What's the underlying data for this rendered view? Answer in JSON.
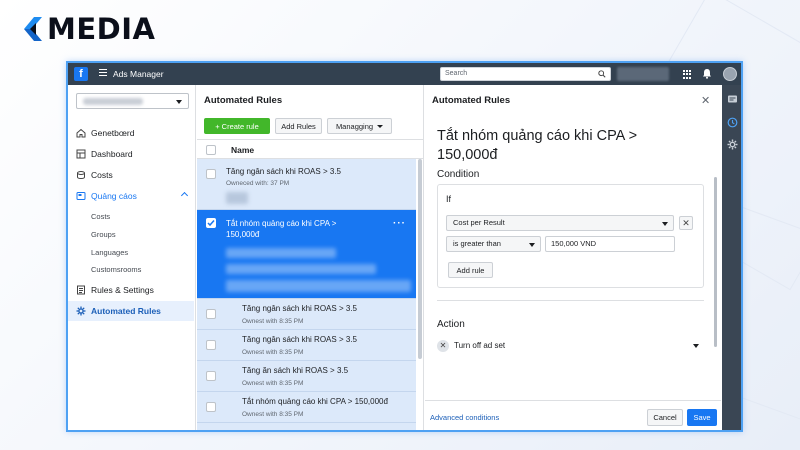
{
  "brand": {
    "logo_text": "MEDIA"
  },
  "topbar": {
    "app_title": "Ads Manager",
    "search_placeholder": "Search"
  },
  "sidebar": {
    "items": [
      {
        "label": "Genetbœrd",
        "icon": "home-icon"
      },
      {
        "label": "Dashboard",
        "icon": "dashboard-icon"
      },
      {
        "label": "Costs",
        "icon": "coins-icon"
      },
      {
        "label": "Quảng cáos",
        "icon": "ads-icon",
        "expanded": true
      },
      {
        "label": "Costs",
        "sub": true
      },
      {
        "label": "Groups",
        "sub": true
      },
      {
        "label": "Languages",
        "sub": true
      },
      {
        "label": "Customsrooms",
        "sub": true
      },
      {
        "label": "Rules & Settings",
        "icon": "rules-icon"
      },
      {
        "label": "Automated Rules",
        "icon": "gear-icon",
        "active": true
      }
    ]
  },
  "list": {
    "title": "Automated Rules",
    "create_label": "+ Create rule",
    "add_label": "Add Rules",
    "manage_label": "Managging",
    "column_name": "Name",
    "rows": [
      {
        "name": "Tăng ngân sách khi ROAS > 3.5",
        "meta": "Owneced with: 37 PM"
      },
      {
        "name": "Tắt nhóm quảng cáo khi CPA >\n150,000đ",
        "meta": "",
        "selected": true
      },
      {
        "name": "Tăng ngân sách khi ROAS > 3.5",
        "meta": "Ownest with 8:35 PM"
      },
      {
        "name": "Tăng ngân sách khi ROAS > 3.5",
        "meta": "Ownest with 8:35 PM"
      },
      {
        "name": "Tăng ăn sách khi ROAS > 3.5",
        "meta": "Ownest with 8:35 PM"
      },
      {
        "name": "Tắt nhóm quảng cáo khi CPA > 150,000đ",
        "meta": "Ownest with 8:35 PM"
      }
    ]
  },
  "detail": {
    "panel_title": "Automated Rules",
    "heading": "Tắt nhóm quảng cáo khi CPA > 150,000đ",
    "condition_label": "Condition",
    "if_label": "If",
    "metric": "Cost per Result",
    "operator": "is greater than",
    "value": "150,000 VND",
    "add_rule_label": "Add rule",
    "action_label": "Action",
    "action_value": "Turn off ad set",
    "advanced_link": "Advanced conditions",
    "cancel_label": "Cancel",
    "save_label": "Save"
  },
  "colors": {
    "primary": "#1877f2",
    "green": "#42b72a",
    "topbar": "#334150",
    "selected_row": "#1877f2",
    "row_bg": "#dce9fa"
  }
}
